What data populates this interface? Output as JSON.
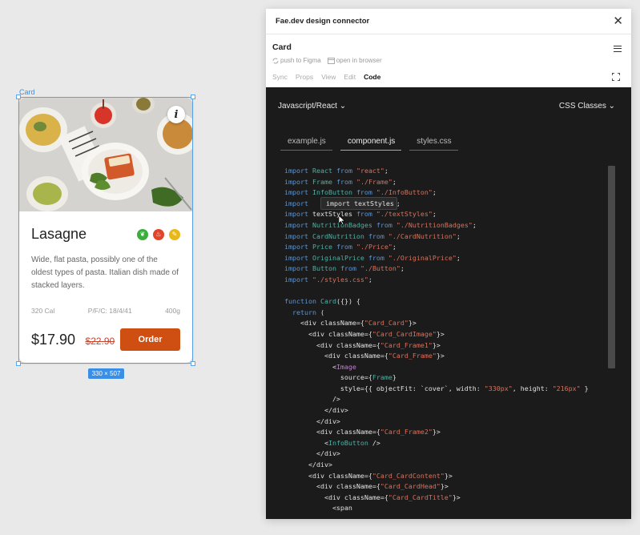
{
  "canvas": {
    "frame_label": "Card",
    "size_badge": "330 × 507"
  },
  "card": {
    "title": "Lasagne",
    "description": "Wide, flat pasta, possibly one of the oldest types of pasta. Italian dish made of stacked layers.",
    "calories": "320 Cal",
    "pfc": "P/F/C: 18/4/41",
    "weight": "400g",
    "price": "$17.90",
    "original_price": "$22.90",
    "order_label": "Order",
    "info_glyph": "i",
    "badges": [
      {
        "icon": "leaf-icon",
        "color": "#3aae3a",
        "glyph": "❦"
      },
      {
        "icon": "flame-icon",
        "color": "#e0442a",
        "glyph": "♨"
      },
      {
        "icon": "pepper-icon",
        "color": "#e8b71a",
        "glyph": "✎"
      }
    ]
  },
  "panel": {
    "title": "Fae.dev design connector",
    "close_glyph": "✕",
    "component_name": "Card",
    "actions": {
      "push": "push to Figma",
      "open": "open in browser"
    },
    "tabs": [
      "Sync",
      "Props",
      "View",
      "Edit",
      "Code"
    ],
    "active_tab": "Code",
    "framework_select": "Javascript/React",
    "style_select": "CSS Classes",
    "file_tabs": [
      "example.js",
      "component.js",
      "styles.css"
    ],
    "active_file": "component.js",
    "tooltip": "import textStyles",
    "code_lines": [
      [
        [
          "kw",
          "import"
        ],
        [
          "plain",
          " "
        ],
        [
          "cmp",
          "React"
        ],
        [
          "plain",
          " "
        ],
        [
          "kw",
          "from"
        ],
        [
          "plain",
          " "
        ],
        [
          "str",
          "\"react\""
        ],
        [
          "plain",
          ";"
        ]
      ],
      [
        [
          "kw",
          "import"
        ],
        [
          "plain",
          " "
        ],
        [
          "cmp",
          "Frame"
        ],
        [
          "plain",
          " "
        ],
        [
          "kw",
          "from"
        ],
        [
          "plain",
          " "
        ],
        [
          "str",
          "\"./Frame\""
        ],
        [
          "plain",
          ";"
        ]
      ],
      [
        [
          "kw",
          "import"
        ],
        [
          "plain",
          " "
        ],
        [
          "cmp",
          "InfoButton"
        ],
        [
          "plain",
          " "
        ],
        [
          "kw",
          "from"
        ],
        [
          "plain",
          " "
        ],
        [
          "str",
          "\"./InfoButton\""
        ],
        [
          "plain",
          ";"
        ]
      ],
      [
        [
          "kw",
          "import"
        ],
        [
          "plain",
          "                    "
        ],
        [
          "str",
          "s\""
        ],
        [
          "plain",
          ";"
        ]
      ],
      [
        [
          "kw",
          "import"
        ],
        [
          "plain",
          " "
        ],
        [
          "plain",
          "textStyles"
        ],
        [
          "plain",
          " "
        ],
        [
          "kw",
          "from"
        ],
        [
          "plain",
          " "
        ],
        [
          "str",
          "\"./textStyles\""
        ],
        [
          "plain",
          ";"
        ]
      ],
      [
        [
          "kw",
          "import"
        ],
        [
          "plain",
          " "
        ],
        [
          "cmp",
          "NutritionBadges"
        ],
        [
          "plain",
          " "
        ],
        [
          "kw",
          "from"
        ],
        [
          "plain",
          " "
        ],
        [
          "str",
          "\"./NutritionBadges\""
        ],
        [
          "plain",
          ";"
        ]
      ],
      [
        [
          "kw",
          "import"
        ],
        [
          "plain",
          " "
        ],
        [
          "cmp",
          "CardNutrition"
        ],
        [
          "plain",
          " "
        ],
        [
          "kw",
          "from"
        ],
        [
          "plain",
          " "
        ],
        [
          "str",
          "\"./CardNutrition\""
        ],
        [
          "plain",
          ";"
        ]
      ],
      [
        [
          "kw",
          "import"
        ],
        [
          "plain",
          " "
        ],
        [
          "cmp",
          "Price"
        ],
        [
          "plain",
          " "
        ],
        [
          "kw",
          "from"
        ],
        [
          "plain",
          " "
        ],
        [
          "str",
          "\"./Price\""
        ],
        [
          "plain",
          ";"
        ]
      ],
      [
        [
          "kw",
          "import"
        ],
        [
          "plain",
          " "
        ],
        [
          "cmp",
          "OriginalPrice"
        ],
        [
          "plain",
          " "
        ],
        [
          "kw",
          "from"
        ],
        [
          "plain",
          " "
        ],
        [
          "str",
          "\"./OriginalPrice\""
        ],
        [
          "plain",
          ";"
        ]
      ],
      [
        [
          "kw",
          "import"
        ],
        [
          "plain",
          " "
        ],
        [
          "cmp",
          "Button"
        ],
        [
          "plain",
          " "
        ],
        [
          "kw",
          "from"
        ],
        [
          "plain",
          " "
        ],
        [
          "str",
          "\"./Button\""
        ],
        [
          "plain",
          ";"
        ]
      ],
      [
        [
          "kw",
          "import"
        ],
        [
          "plain",
          " "
        ],
        [
          "str",
          "\"./styles.css\""
        ],
        [
          "plain",
          ";"
        ]
      ],
      [
        [
          "plain",
          ""
        ]
      ],
      [
        [
          "kw",
          "function"
        ],
        [
          "plain",
          " "
        ],
        [
          "cmp",
          "Card"
        ],
        [
          "plain",
          "({}) {"
        ]
      ],
      [
        [
          "plain",
          "  "
        ],
        [
          "kw",
          "return"
        ],
        [
          "plain",
          " ("
        ]
      ],
      [
        [
          "plain",
          "    <div className={"
        ],
        [
          "str",
          "\"Card_Card\""
        ],
        [
          "plain",
          "}>"
        ]
      ],
      [
        [
          "plain",
          "      <div className={"
        ],
        [
          "str",
          "\"Card_CardImage\""
        ],
        [
          "plain",
          "}>"
        ]
      ],
      [
        [
          "plain",
          "        <div className={"
        ],
        [
          "str",
          "\"Card_Frame1\""
        ],
        [
          "plain",
          "}>"
        ]
      ],
      [
        [
          "plain",
          "          <div className={"
        ],
        [
          "str",
          "\"Card_Frame\""
        ],
        [
          "plain",
          "}>"
        ]
      ],
      [
        [
          "plain",
          "            <"
        ],
        [
          "tag",
          "Image"
        ]
      ],
      [
        [
          "plain",
          "              source={"
        ],
        [
          "cmp",
          "Frame"
        ],
        [
          "plain",
          "}"
        ]
      ],
      [
        [
          "plain",
          "              style={{ objectFit: `cover`, width: "
        ],
        [
          "str",
          "\"330px\""
        ],
        [
          "plain",
          ", height: "
        ],
        [
          "str",
          "\"216px\""
        ],
        [
          "plain",
          " }"
        ]
      ],
      [
        [
          "plain",
          "            />"
        ]
      ],
      [
        [
          "plain",
          "          </div>"
        ]
      ],
      [
        [
          "plain",
          "        </div>"
        ]
      ],
      [
        [
          "plain",
          "        <div className={"
        ],
        [
          "str",
          "\"Card_Frame2\""
        ],
        [
          "plain",
          "}>"
        ]
      ],
      [
        [
          "plain",
          "          <"
        ],
        [
          "cmp",
          "InfoButton"
        ],
        [
          "plain",
          " />"
        ]
      ],
      [
        [
          "plain",
          "        </div>"
        ]
      ],
      [
        [
          "plain",
          "      </div>"
        ]
      ],
      [
        [
          "plain",
          "      <div className={"
        ],
        [
          "str",
          "\"Card_CardContent\""
        ],
        [
          "plain",
          "}>"
        ]
      ],
      [
        [
          "plain",
          "        <div className={"
        ],
        [
          "str",
          "\"Card_CardHead\""
        ],
        [
          "plain",
          "}>"
        ]
      ],
      [
        [
          "plain",
          "          <div className={"
        ],
        [
          "str",
          "\"Card_CardTitle\""
        ],
        [
          "plain",
          "}>"
        ]
      ],
      [
        [
          "plain",
          "            <span"
        ]
      ]
    ]
  },
  "colors": {
    "selection": "#5aa7ee",
    "order_button": "#cf4f13",
    "code_bg": "#1b1b1b"
  }
}
